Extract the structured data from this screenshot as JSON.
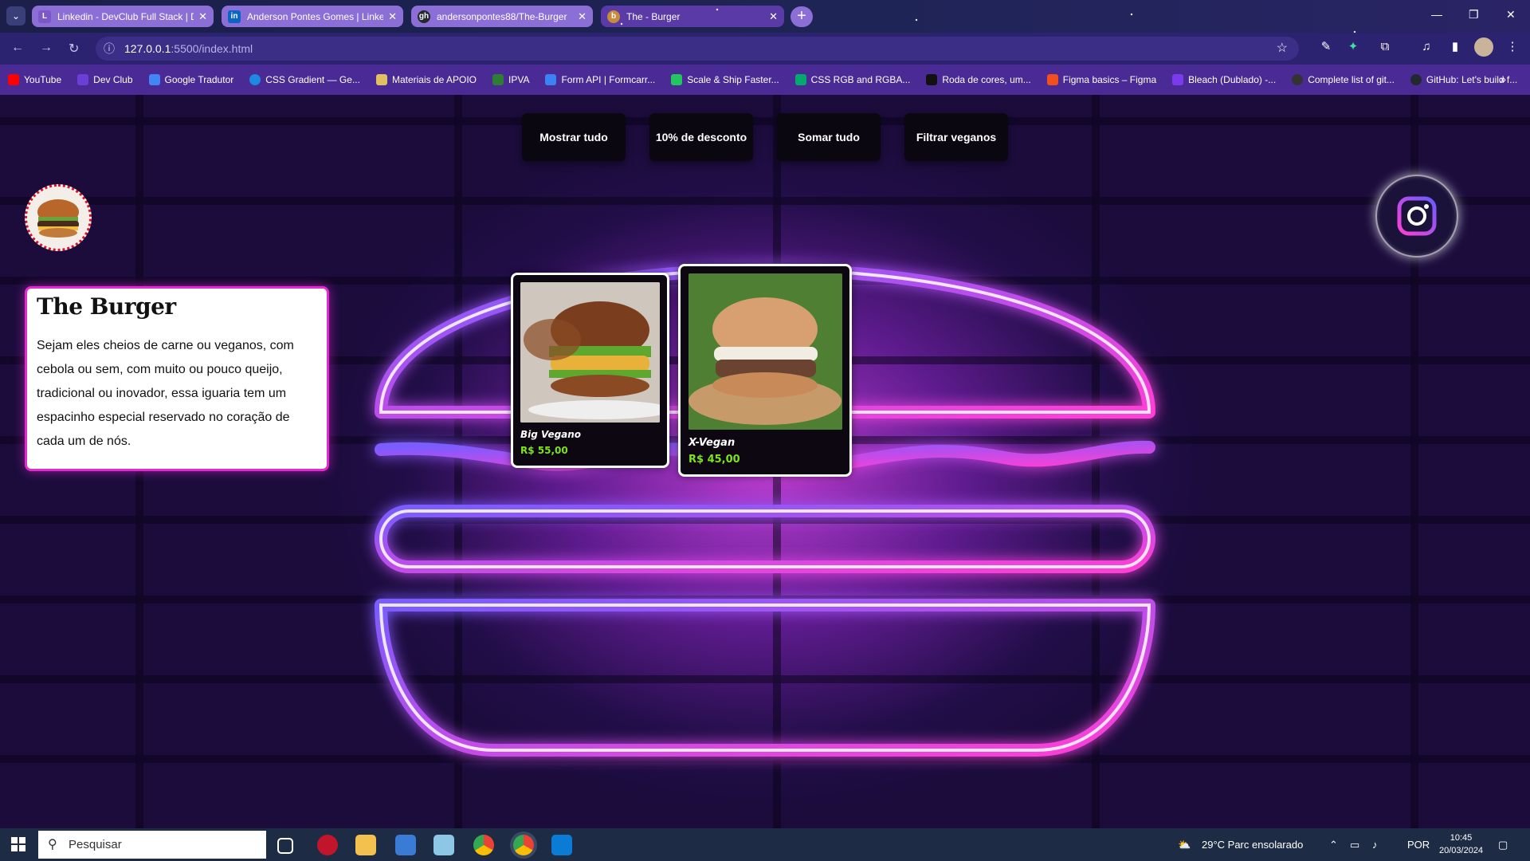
{
  "browser": {
    "tabs": [
      {
        "title": "Linkedin - DevClub Full Stack | D",
        "favicon": "L"
      },
      {
        "title": "Anderson Pontes Gomes | Linke",
        "favicon": "in"
      },
      {
        "title": "andersonpontes88/The-Burger",
        "favicon": "gh"
      },
      {
        "title": "The - Burger",
        "favicon": "b",
        "active": true
      }
    ],
    "url_host": "127.0.0.1",
    "url_path": ":5500/index.html",
    "bookmarks": [
      {
        "label": "YouTube",
        "color": "#ff0000"
      },
      {
        "label": "Dev Club",
        "color": "#6b3fd6"
      },
      {
        "label": "Google Tradutor",
        "color": "#4285f4"
      },
      {
        "label": "CSS Gradient — Ge...",
        "color": "#1e88e5"
      },
      {
        "label": "Materiais de APOIO",
        "color": "#e0c060"
      },
      {
        "label": "IPVA",
        "color": "#2e7d32"
      },
      {
        "label": "Form API | Formcarr...",
        "color": "#3b82f6"
      },
      {
        "label": "Scale & Ship Faster...",
        "color": "#22c55e"
      },
      {
        "label": "CSS RGB and RGBA...",
        "color": "#04aa6d"
      },
      {
        "label": "Roda de cores, um...",
        "color": "#111111"
      },
      {
        "label": "Figma basics – Figma",
        "color": "#f24e1e"
      },
      {
        "label": "Bleach (Dublado) -...",
        "color": "#7c3aed"
      },
      {
        "label": "Complete list of git...",
        "color": "#333333"
      },
      {
        "label": "GitHub: Let's build f...",
        "color": "#24292f"
      }
    ]
  },
  "page": {
    "buttons": [
      "Mostrar tudo",
      "10% de desconto",
      "Somar tudo",
      "Filtrar veganos"
    ],
    "info": {
      "title": "The Burger",
      "text": "Sejam eles cheios de carne ou veganos, com cebola ou sem, com muito ou pouco queijo, tradicional ou inovador, essa iguaria tem um espacinho especial reservado no coração de cada um de nós."
    },
    "products": [
      {
        "name": "Big Vegano",
        "price": "R$ 55,00"
      },
      {
        "name": "X-Vegan",
        "price": "R$ 45,00"
      }
    ],
    "colors": {
      "neon_blue": "#7a5cff",
      "neon_pink": "#ff3fd6",
      "price_green": "#7be51b",
      "card_border": "#e22ad0"
    }
  },
  "taskbar": {
    "search_placeholder": "Pesquisar",
    "weather": "29°C  Parc ensolarado",
    "lang": "POR",
    "time": "10:45",
    "date": "20/03/2024"
  }
}
